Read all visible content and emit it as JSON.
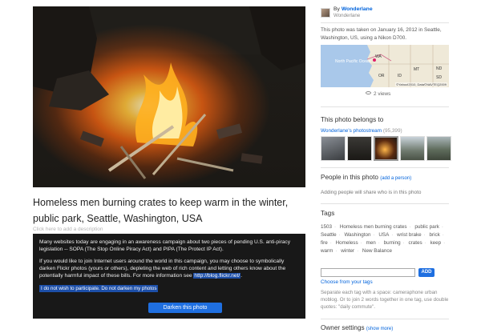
{
  "photo": {
    "title": "Homeless men burning crates to keep warm in the winter, public park, Seattle, Washington, USA",
    "add_description": "Click here to add a description"
  },
  "campaign": {
    "paragraph1": "Many websites today are engaging in an awareness campaign about two pieces of pending U.S. anti-piracy legislation -- SOPA (The Stop Online Piracy Act) and PIPA (The Protect IP Act).",
    "paragraph2": "If you would like to join Internet users around the world in this campaign, you may choose to symbolically darken Flickr photos (yours or others), depleting the web of rich content and letting others know about the potentially harmful impact of these bills. For more information see",
    "link": "http://blog.flickr.net/",
    "link_suffix": ".",
    "opt_out": "I do not wish to participate. Do not darken my photos",
    "darken_button": "Darken this photo"
  },
  "owner": {
    "by_prefix": "By",
    "name": "Wonderlane",
    "sub": "Wonderlane"
  },
  "taken_text": "This photo was taken on January 16, 2012 in Seattle, Washington, US, using a Nikon D700.",
  "map": {
    "ocean_label": "North Pacific Ocean",
    "state_labels": [
      "WA",
      "MT",
      "ND",
      "SD",
      "OR",
      "ID"
    ],
    "copyright": "©Yahoo!2010, Data©NAVTEQ2009"
  },
  "views": "2 views",
  "belongs": {
    "heading": "This photo belongs to",
    "stream_name": "Wonderlane's photostream",
    "stream_count": "(95,399)"
  },
  "people": {
    "heading": "People in this photo",
    "add_link": "(add a person)",
    "note": "Adding people will share who is in this photo"
  },
  "tags": {
    "heading": "Tags",
    "items": [
      "1503",
      "Homeless men burning crates",
      "public park",
      "Seattle",
      "Washington",
      "USA",
      "wrist brake",
      "brick",
      "fire",
      "Homeless",
      "men",
      "burning",
      "crates",
      "keep",
      "warm",
      "winter",
      "New Balance"
    ],
    "input_value": "",
    "add_button": "ADD",
    "choose_link": "Choose from your tags",
    "help_text": "Separate each tag with a space: cameraphone urban moblog. Or to join 2 words together in one tag, use double quotes: \"daily commute\"."
  },
  "owner_settings": {
    "heading": "Owner settings",
    "more_link": "(show more)"
  }
}
